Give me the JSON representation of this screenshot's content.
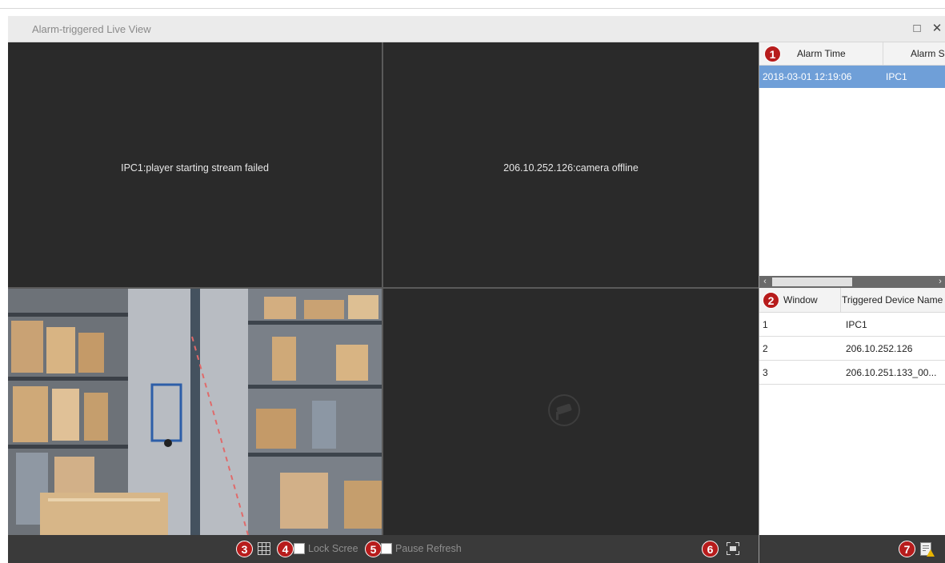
{
  "window": {
    "title": "Alarm-triggered Live View",
    "maximize_icon": "maximize-icon",
    "close_icon": "close-icon"
  },
  "video_tiles": [
    {
      "message": "IPC1:player starting stream failed"
    },
    {
      "message": "206.10.252.126:camera offline"
    },
    {
      "message": "",
      "content": "warehouse-live-feed"
    },
    {
      "message": "",
      "content": "no-video-camera-icon"
    }
  ],
  "bottom_bar": {
    "layout_icon": "grid-layout-icon",
    "lock_screen_label": "Lock Scree",
    "pause_refresh_label": "Pause Refresh",
    "fullscreen_icon": "fullscreen-icon"
  },
  "alarm_table": {
    "columns": [
      "Alarm Time",
      "Alarm S"
    ],
    "rows": [
      {
        "time": "2018-03-01 12:19:06",
        "source": "IPC1",
        "selected": true
      }
    ]
  },
  "device_table": {
    "columns": [
      "Window",
      "Triggered Device Name"
    ],
    "rows": [
      {
        "window": "1",
        "device": "IPC1"
      },
      {
        "window": "2",
        "device": "206.10.252.126"
      },
      {
        "window": "3",
        "device": "206.10.251.133_00..."
      }
    ]
  },
  "side_bottom": {
    "log_icon": "alarm-log-icon"
  },
  "callouts": [
    "1",
    "2",
    "3",
    "4",
    "5",
    "6",
    "7"
  ],
  "colors": {
    "video_bg": "#2a2a2a",
    "selected_row": "#6f9fd8",
    "callout": "#b71c1c",
    "toolbar_bg": "#3a3a3a"
  }
}
